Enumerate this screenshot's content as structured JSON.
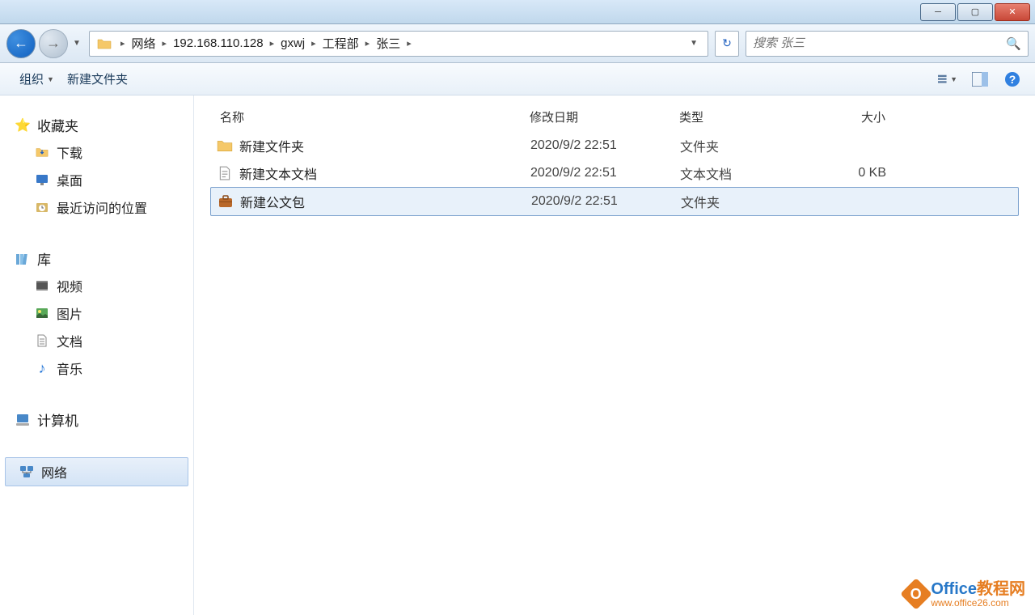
{
  "breadcrumb": {
    "items": [
      "网络",
      "192.168.110.128",
      "gxwj",
      "工程部",
      "张三"
    ]
  },
  "search": {
    "placeholder": "搜索 张三"
  },
  "toolbar": {
    "organize": "组织",
    "newfolder": "新建文件夹"
  },
  "sidebar": {
    "favorites": {
      "header": "收藏夹",
      "items": [
        "下载",
        "桌面",
        "最近访问的位置"
      ]
    },
    "libraries": {
      "header": "库",
      "items": [
        "视频",
        "图片",
        "文档",
        "音乐"
      ]
    },
    "computer": {
      "header": "计算机"
    },
    "network": {
      "header": "网络"
    }
  },
  "columns": {
    "name": "名称",
    "date": "修改日期",
    "type": "类型",
    "size": "大小"
  },
  "files": [
    {
      "name": "新建文件夹",
      "date": "2020/9/2 22:51",
      "type": "文件夹",
      "size": ""
    },
    {
      "name": "新建文本文档",
      "date": "2020/9/2 22:51",
      "type": "文本文档",
      "size": "0 KB"
    },
    {
      "name": "新建公文包",
      "date": "2020/9/2 22:51",
      "type": "文件夹",
      "size": ""
    }
  ],
  "watermark": {
    "title1": "Office",
    "title2": "教程网",
    "url": "www.office26.com"
  }
}
